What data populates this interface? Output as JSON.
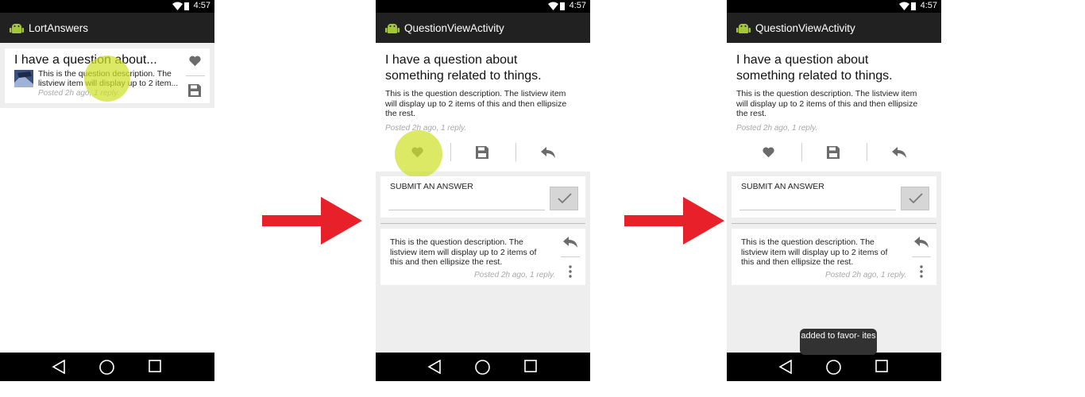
{
  "status": {
    "time": "4:57"
  },
  "screen1": {
    "app_title": "LortAnswers",
    "item": {
      "title": "I have a question about...",
      "description": "This is the question description. The listview item will display up to 2 item...",
      "meta": "Posted 2h ago, 1 reply."
    }
  },
  "screen2": {
    "app_title": "QuestionViewActivity",
    "question_title": "I have a question about something related to things.",
    "question_body": "This is the question description. The listview item will display up to 2 items of this and then ellipsize the rest.",
    "meta": "Posted 2h ago, 1 reply.",
    "answer_label": "SUBMIT AN ANSWER",
    "answer_value": "",
    "reply_body": "This is the question description. The listview item will display up to 2 items of this and then ellipsize the rest.",
    "reply_meta": "Posted 2h ago, 1 reply."
  },
  "screen3": {
    "app_title": "QuestionViewActivity",
    "question_title": "I have a question about something related to things.",
    "question_body": "This is the question description. The listview item will display up to 2 items of this and then ellipsize the rest.",
    "meta": "Posted 2h ago, 1 reply.",
    "answer_label": "SUBMIT AN ANSWER",
    "answer_value": "",
    "reply_body": "This is the question description. The listview item will display up to 2 items of this and then ellipsize the rest.",
    "reply_meta": "Posted 2h ago, 1 reply.",
    "toast": "added to favor- ites"
  },
  "icons": [
    "android-logo-icon",
    "heart-icon",
    "save-icon",
    "reply-icon",
    "more-vert-icon",
    "check-icon",
    "back-nav-icon",
    "home-nav-icon",
    "recents-nav-icon",
    "wifi-icon",
    "battery-icon"
  ],
  "colors": {
    "arrow": "#e8202a",
    "ripple": "#cde128",
    "appbar": "#212121",
    "icon": "#6b6b6b",
    "android": "#a4c639"
  }
}
